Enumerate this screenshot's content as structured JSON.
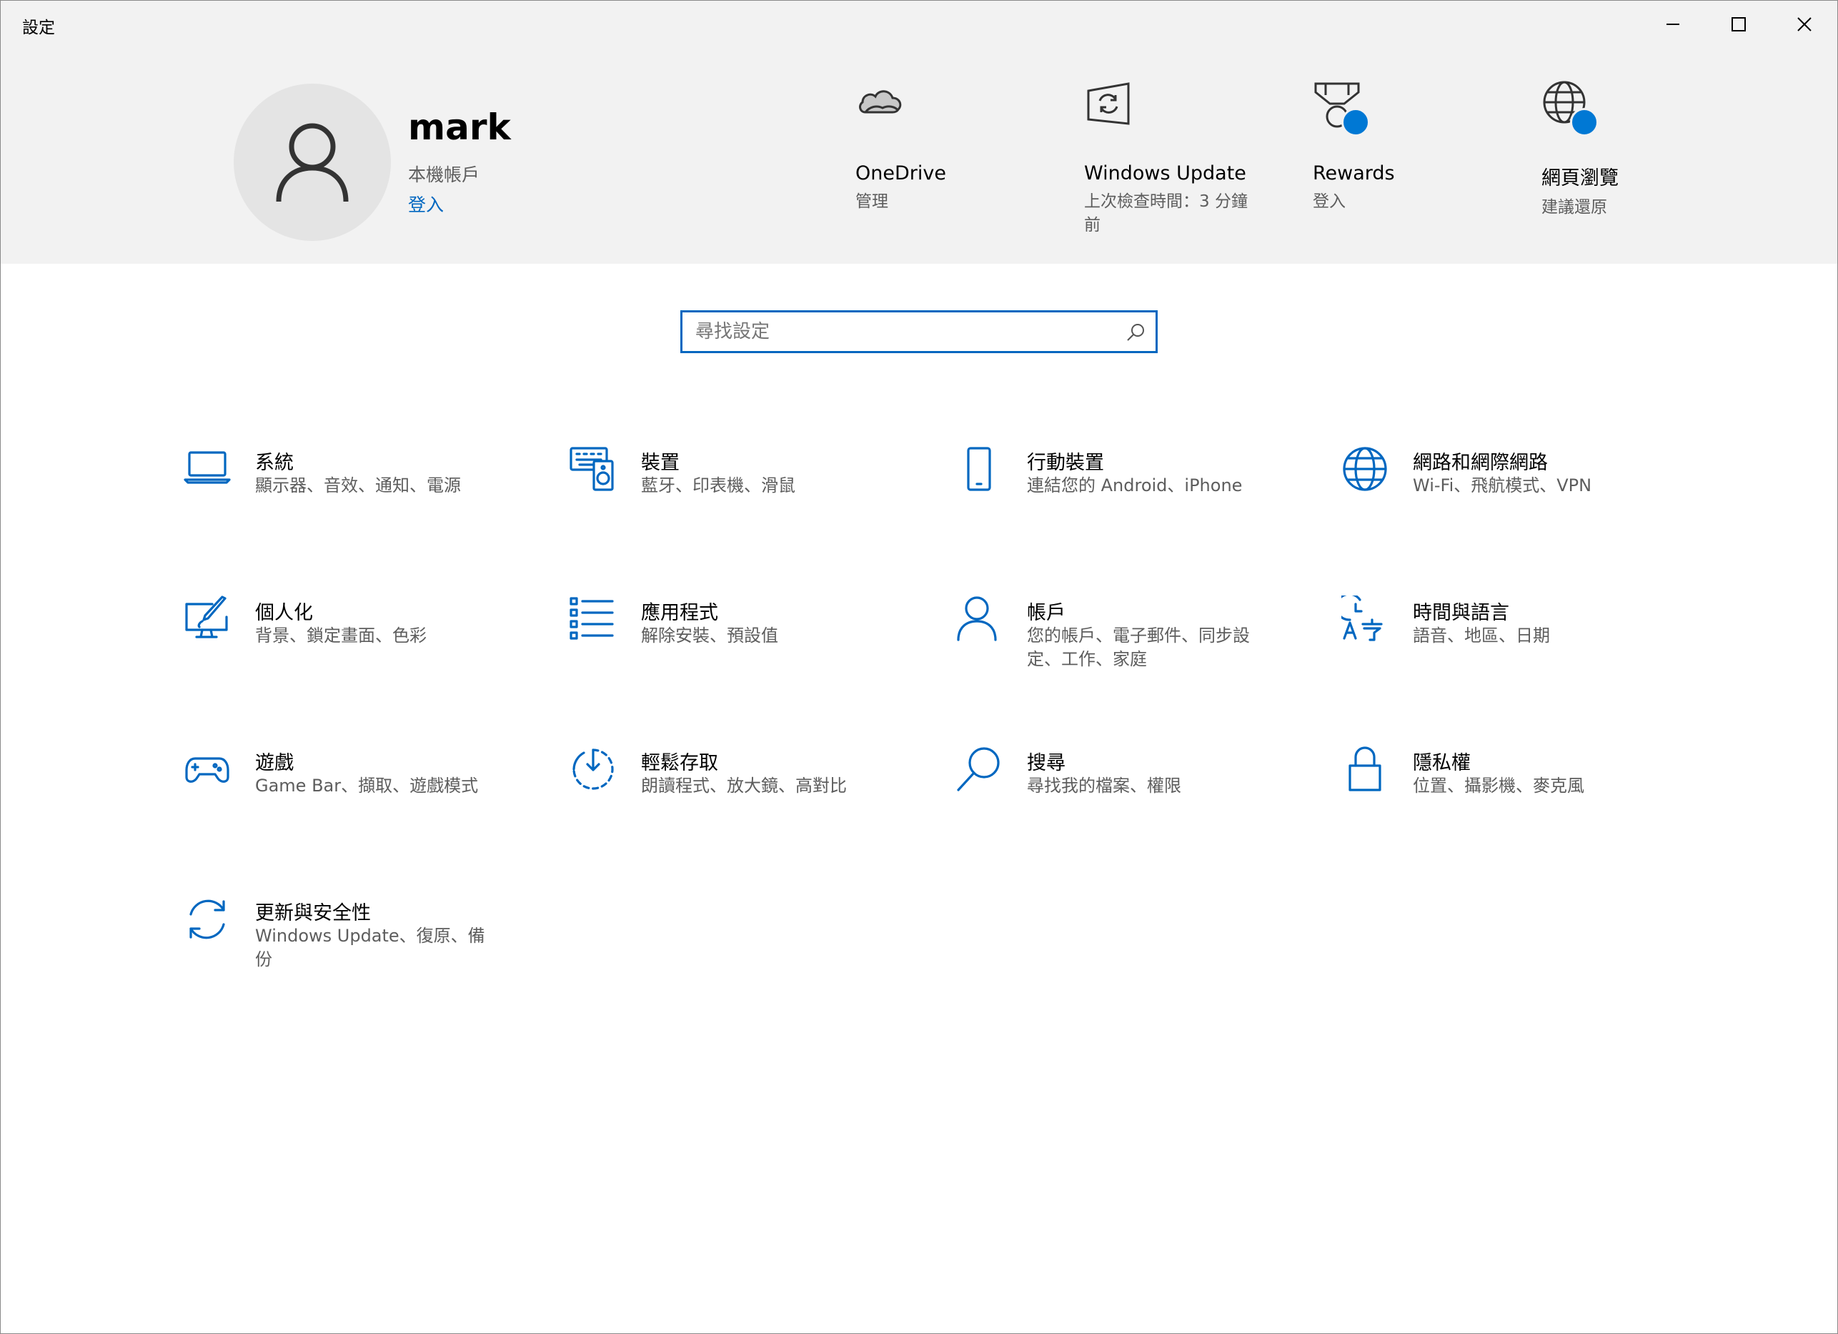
{
  "window": {
    "title": "設定"
  },
  "user": {
    "name": "mark",
    "account_type": "本機帳戶",
    "signin_link": "登入"
  },
  "quick_links": [
    {
      "title": "OneDrive",
      "subtitle": "管理",
      "icon": "cloud-icon"
    },
    {
      "title": "Windows Update",
      "subtitle": "上次檢查時間：3 分鐘前",
      "icon": "windows-update-icon"
    },
    {
      "title": "Rewards",
      "subtitle": "登入",
      "icon": "rewards-medal-icon"
    },
    {
      "title": "網頁瀏覽",
      "subtitle": "建議還原",
      "icon": "globe-icon"
    }
  ],
  "search": {
    "placeholder": "尋找設定"
  },
  "categories": [
    {
      "title": "系統",
      "subtitle": "顯示器、音效、通知、電源",
      "icon": "laptop-icon"
    },
    {
      "title": "裝置",
      "subtitle": "藍牙、印表機、滑鼠",
      "icon": "devices-icon"
    },
    {
      "title": "行動裝置",
      "subtitle": "連結您的 Android、iPhone",
      "icon": "phone-icon"
    },
    {
      "title": "網路和網際網路",
      "subtitle": "Wi-Fi、飛航模式、VPN",
      "icon": "globe-icon"
    },
    {
      "title": "個人化",
      "subtitle": "背景、鎖定畫面、色彩",
      "icon": "personalization-icon"
    },
    {
      "title": "應用程式",
      "subtitle": "解除安裝、預設值",
      "icon": "apps-list-icon"
    },
    {
      "title": "帳戶",
      "subtitle": "您的帳戶、電子郵件、同步設定、工作、家庭",
      "icon": "person-icon"
    },
    {
      "title": "時間與語言",
      "subtitle": "語音、地區、日期",
      "icon": "time-language-icon"
    },
    {
      "title": "遊戲",
      "subtitle": "Game Bar、擷取、遊戲模式",
      "icon": "gamepad-icon"
    },
    {
      "title": "輕鬆存取",
      "subtitle": "朗讀程式、放大鏡、高對比",
      "icon": "ease-of-access-icon"
    },
    {
      "title": "搜尋",
      "subtitle": "尋找我的檔案、權限",
      "icon": "search-icon"
    },
    {
      "title": "隱私權",
      "subtitle": "位置、攝影機、麥克風",
      "icon": "lock-icon"
    },
    {
      "title": "更新與安全性",
      "subtitle": "Windows Update、復原、備份",
      "icon": "sync-icon"
    }
  ],
  "colors": {
    "accent": "#0067c0",
    "header_bg": "#f2f2f2",
    "badge": "#0078d4"
  }
}
